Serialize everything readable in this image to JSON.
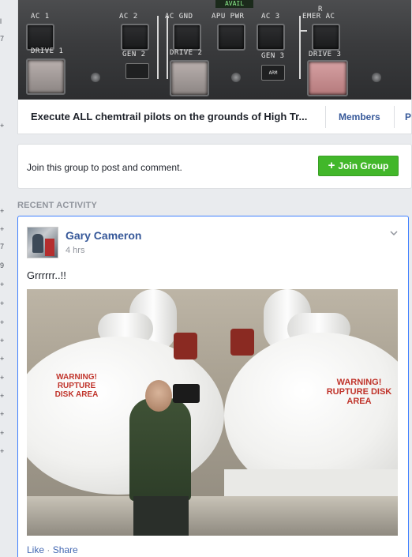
{
  "left_strip": {
    "glyphs": [
      "l",
      "7",
      "+",
      "+",
      "+",
      "7",
      "9",
      "+",
      "+",
      "+",
      "+",
      "+",
      "+",
      "+",
      "+",
      "+",
      "+",
      "+",
      "+",
      "+"
    ]
  },
  "cover": {
    "photo_labels": {
      "ac1": "AC 1",
      "ac2": "AC 2",
      "ac_gnd": "AC GND",
      "avail": "AVAIL",
      "apu_pwr": "APU PWR",
      "ac3": "AC 3",
      "emer_ac": "EMER AC",
      "r": "R",
      "drive1": "DRIVE 1",
      "gen2": "GEN 2",
      "drive2": "DRIVE 2",
      "gen3": "GEN 3",
      "drive3": "DRIVE 3",
      "arm": "ARM"
    },
    "group_title": "Execute ALL chemtrail pilots on the grounds of High Tr...",
    "tabs": [
      "Members",
      "Photos"
    ]
  },
  "join": {
    "prompt": "Join this group to post and comment.",
    "button_label": "Join Group",
    "button_color": "#42b72a"
  },
  "recent_activity": {
    "header": "RECENT ACTIVITY",
    "post": {
      "author": "Gary Cameron",
      "timestamp": "4 hrs",
      "text": "Grrrrrr..!!",
      "image_warning_left": "WARNING! RUPTURE DISK AREA",
      "image_warning_right": "WARNING! RUPTURE DISK AREA",
      "actions": {
        "like": "Like",
        "separator": "·",
        "share": "Share"
      }
    }
  },
  "colors": {
    "link_blue": "#365899",
    "action_blue": "#4267b2",
    "focus_border": "#4080ff",
    "background": "#e9ebee"
  }
}
